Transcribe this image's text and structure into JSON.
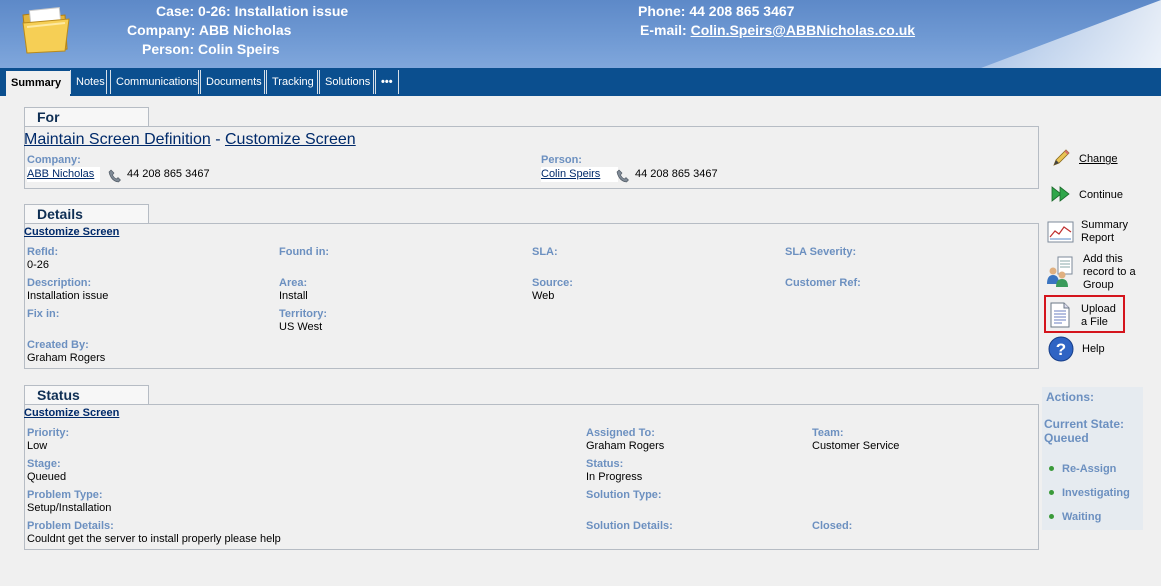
{
  "header": {
    "case_label": "Case:",
    "case_value": "0-26: Installation issue",
    "company_label": "Company:",
    "company_value": "ABB Nicholas",
    "person_label": "Person:",
    "person_value": "Colin Speirs",
    "phone_label": "Phone:",
    "phone_value": "44 208 865 3467",
    "email_label": "E-mail:",
    "email_value": "Colin.Speirs@ABBNicholas.co.uk"
  },
  "tabs": [
    "Summary",
    "Notes",
    "Communications",
    "Documents",
    "Tracking",
    "Solutions",
    "•••"
  ],
  "for": {
    "title": "For",
    "link1": "Maintain Screen Definition",
    "sep": " - ",
    "link2": "Customize Screen",
    "company_label": "Company:",
    "company_value": "ABB Nicholas",
    "company_phone": "44 208 865 3467",
    "person_label": "Person:",
    "person_value": "Colin Speirs",
    "person_phone": "44 208 865 3467"
  },
  "details": {
    "title": "Details",
    "sublink": "Customize Screen",
    "refid_label": "RefId:",
    "refid_value": "0-26",
    "foundin_label": "Found in:",
    "sla_label": "SLA:",
    "slasev_label": "SLA Severity:",
    "desc_label": "Description:",
    "desc_value": "Installation issue",
    "area_label": "Area:",
    "area_value": "Install",
    "source_label": "Source:",
    "source_value": "Web",
    "custref_label": "Customer Ref:",
    "fixin_label": "Fix in:",
    "territory_label": "Territory:",
    "territory_value": "US West",
    "createdby_label": "Created By:",
    "createdby_value": "Graham Rogers"
  },
  "status": {
    "title": "Status",
    "sublink": "Customize Screen",
    "priority_label": "Priority:",
    "priority_value": "Low",
    "assigned_label": "Assigned To:",
    "assigned_value": "Graham Rogers",
    "team_label": "Team:",
    "team_value": "Customer Service",
    "stage_label": "Stage:",
    "stage_value": "Queued",
    "status_label": "Status:",
    "status_value": "In Progress",
    "ptype_label": "Problem Type:",
    "ptype_value": "Setup/Installation",
    "stype_label": "Solution Type:",
    "pdetails_label": "Problem Details:",
    "pdetails_value": "Couldnt get the server to install properly please help",
    "sdetails_label": "Solution Details:",
    "closed_label": "Closed:"
  },
  "actions": {
    "change": "Change",
    "continue": "Continue",
    "summary_report_1": "Summary",
    "summary_report_2": "Report",
    "add_group_1": "Add this",
    "add_group_2": "record to a",
    "add_group_3": "Group",
    "upload_1": "Upload",
    "upload_2": "a File",
    "help": "Help"
  },
  "workflow": {
    "actions_label": "Actions:",
    "state_label": "Current State:",
    "state_value": "Queued",
    "items": [
      "Re-Assign",
      "Investigating",
      "Waiting"
    ]
  },
  "colors": {
    "header_blue": "#6f99d3",
    "tabbar_blue": "#0b4f8f",
    "label_blue": "#6c90c0",
    "highlight_red": "#d4141c"
  }
}
